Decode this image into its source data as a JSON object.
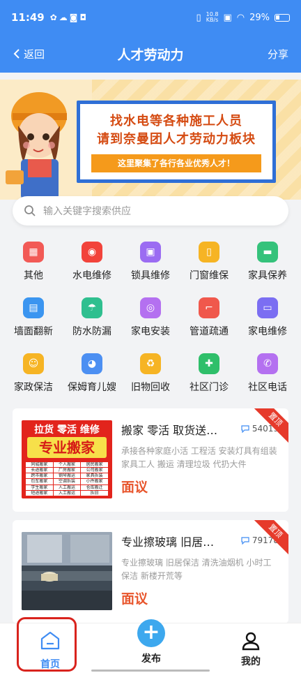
{
  "status": {
    "time": "11:49",
    "speed_top": "10.8",
    "speed_bottom": "KB/s",
    "battery": "29%"
  },
  "nav": {
    "back": "返回",
    "title": "人才劳动力",
    "share": "分享"
  },
  "banner": {
    "line1": "找水电等各种施工人员",
    "line2": "请到奈曼团人才劳动力板块",
    "tagline": "这里聚集了各行各业优秀人才！"
  },
  "search": {
    "placeholder": "输入关键字搜索供应"
  },
  "categories": [
    {
      "label": "其他",
      "icon": "grid-icon",
      "color": "#f25a56",
      "glyph": "▦"
    },
    {
      "label": "水电维修",
      "icon": "flame-icon",
      "color": "#f2433b",
      "glyph": "◉"
    },
    {
      "label": "锁具维修",
      "icon": "lock-icon",
      "color": "#9b6cf2",
      "glyph": "▣"
    },
    {
      "label": "门窗维保",
      "icon": "door-icon",
      "color": "#f6b424",
      "glyph": "▯"
    },
    {
      "label": "家具保养",
      "icon": "sofa-icon",
      "color": "#35c27b",
      "glyph": "▬"
    },
    {
      "label": "墙面翻新",
      "icon": "brick-icon",
      "color": "#3b95f0",
      "glyph": "▤"
    },
    {
      "label": "防水防漏",
      "icon": "umbrella-icon",
      "color": "#2fbf8f",
      "glyph": "☂"
    },
    {
      "label": "家电安装",
      "icon": "washer-icon",
      "color": "#b470f0",
      "glyph": "◎"
    },
    {
      "label": "管道疏通",
      "icon": "pipe-icon",
      "color": "#f0584c",
      "glyph": "⌐"
    },
    {
      "label": "家电维修",
      "icon": "tv-icon",
      "color": "#7b6ef2",
      "glyph": "▭"
    },
    {
      "label": "家政保洁",
      "icon": "cleaner-icon",
      "color": "#f6b424",
      "glyph": "☺"
    },
    {
      "label": "保姆育儿嫂",
      "icon": "baby-icon",
      "color": "#4c8ff2",
      "glyph": "◕"
    },
    {
      "label": "旧物回收",
      "icon": "recycle-icon",
      "color": "#f6b424",
      "glyph": "♻"
    },
    {
      "label": "社区门诊",
      "icon": "clinic-icon",
      "color": "#2fbf6a",
      "glyph": "✚"
    },
    {
      "label": "社区电话",
      "icon": "phone-icon",
      "color": "#b470f0",
      "glyph": "✆"
    }
  ],
  "listings": [
    {
      "title": "搬家 零活 取货送…",
      "views": "54019",
      "desc": "承接各种家庭小活 工程活 安装灯具有组装家具工人 搬运 清理垃圾 代扔大件",
      "price": "面议",
      "ribbon": "置顶",
      "thumb_header": "拉货 零活 维修",
      "thumb_banner": "专业搬家",
      "thumb_items": [
        "同城搬家",
        "个人搬家",
        "居民搬家",
        "长途搬家",
        "厂房搬家",
        "公司搬家",
        "跨市搬家",
        "钢琴搬运",
        "家具拆装",
        "包车搬家",
        "空调拆装",
        "小件搬家",
        "学生搬家",
        "人工搬运",
        "仓库搬迁",
        "短途搬家",
        "入工搬运",
        "拆旧"
      ]
    },
    {
      "title": "专业擦玻璃 旧居…",
      "views": "79178",
      "desc": "专业擦玻璃 旧居保洁 清洗油烟机 小时工保洁 新楼开荒等",
      "price": "面议",
      "ribbon": "置顶"
    }
  ],
  "tabs": {
    "home": "首页",
    "publish": "发布",
    "mine": "我的"
  }
}
